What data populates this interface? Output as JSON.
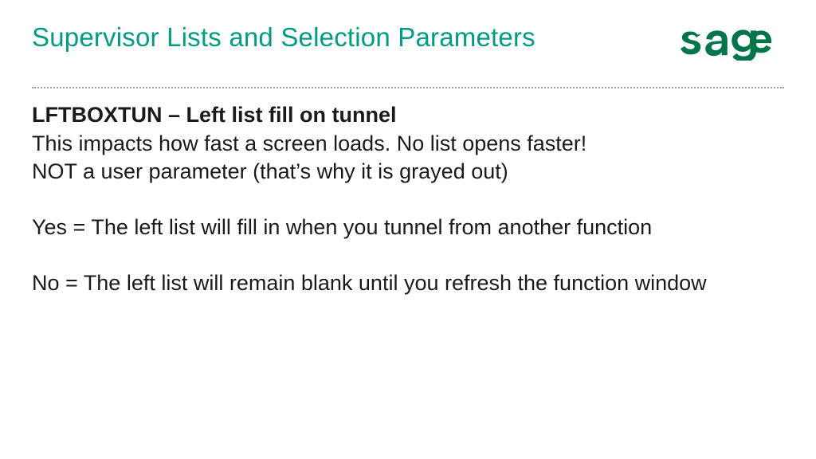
{
  "brand": {
    "name": "sage",
    "color": "#00754a"
  },
  "title": "Supervisor Lists and Selection Parameters",
  "content": {
    "param_code": "LFTBOXTUN",
    "param_sep": " – ",
    "param_name": "Left list fill on tunnel",
    "line1": "This impacts how fast a screen loads.  No list opens faster!",
    "line2": "NOT a user parameter (that’s why it is grayed out)",
    "yes_text": "Yes = The left list will fill in when you tunnel from another function",
    "no_text": "No = The left list will remain blank until you refresh the function window"
  }
}
